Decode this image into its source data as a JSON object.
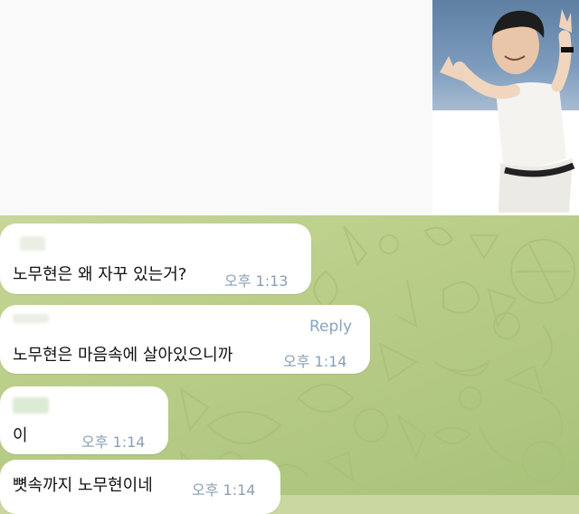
{
  "theme": {
    "chat_background": "#bfd18e",
    "bubble_color": "#ffffff",
    "time_color": "#8aa0b6",
    "reply_color": "#88a4bf"
  },
  "media_message": {
    "photo_icon": "man-waving-photo"
  },
  "messages": [
    {
      "text": "노무현은 왜 자꾸 있는거?",
      "time": "오후 1:13"
    },
    {
      "reply_label": "Reply",
      "text": "노무현은 마음속에 살아있으니까",
      "time": "오후 1:14"
    },
    {
      "text": "이",
      "time": "오후 1:14"
    },
    {
      "text": "뼛속까지 노무현이네",
      "time": "오후 1:14"
    }
  ]
}
